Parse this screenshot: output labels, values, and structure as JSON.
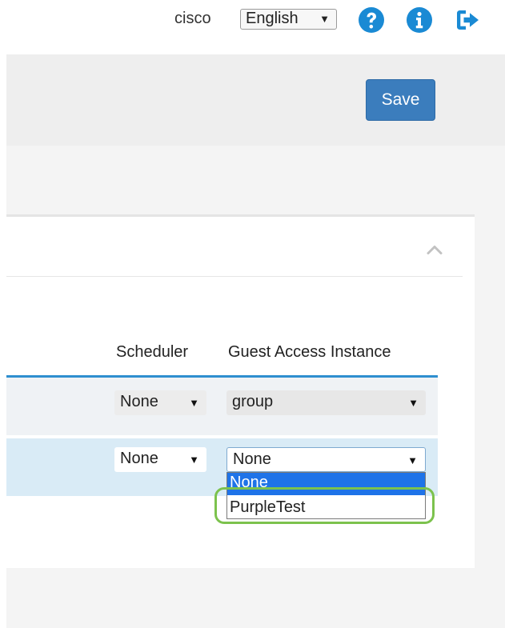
{
  "header": {
    "user": "cisco",
    "language": {
      "selected": "English"
    },
    "icons": [
      "help-icon",
      "info-icon",
      "logout-icon"
    ]
  },
  "toolbar": {
    "save_label": "Save"
  },
  "table": {
    "columns": [
      "Scheduler",
      "Guest Access Instance"
    ],
    "rows": [
      {
        "scheduler": "None",
        "guest_access_instance": "group"
      },
      {
        "scheduler": "None",
        "guest_access_instance": "None"
      }
    ]
  },
  "dropdown": {
    "options": [
      "None",
      "PurpleTest"
    ],
    "selected_index": 0
  },
  "colors": {
    "primary": "#3b7dbd",
    "header_line": "#2e8fcf",
    "icon_blue": "#1a8ad4",
    "option_highlight": "#1e73e8",
    "callout": "#7cc24d",
    "selected_row": "#d9ebf6"
  }
}
